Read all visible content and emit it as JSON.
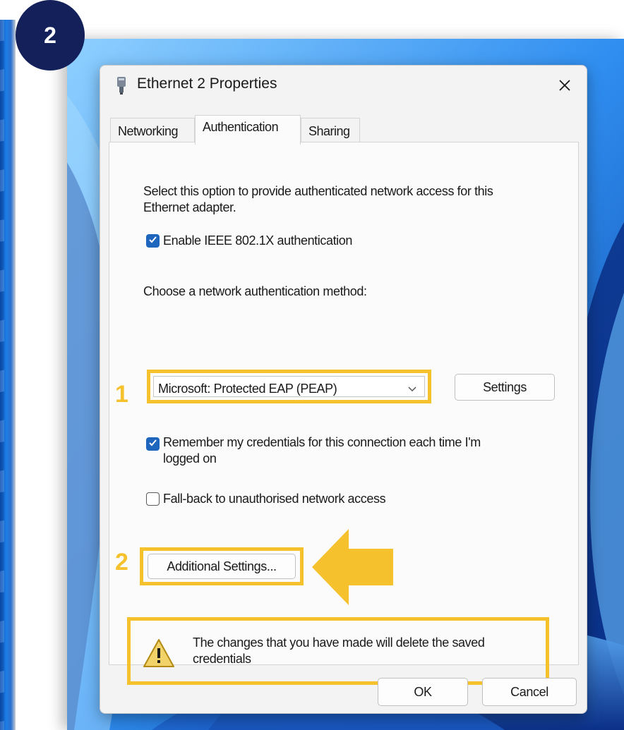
{
  "step_badge": "2",
  "dialog": {
    "title": "Ethernet 2 Properties",
    "close_glyph": "✕",
    "tabs": [
      {
        "label": "Networking"
      },
      {
        "label": "Authentication"
      },
      {
        "label": "Sharing"
      }
    ],
    "active_tab": "Authentication",
    "description": "Select this option to provide authenticated network access for this Ethernet adapter.",
    "enable_8021x": {
      "label": "Enable IEEE 802.1X authentication",
      "checked": true
    },
    "method_label": "Choose a network authentication method:",
    "method_select": {
      "value": "Microsoft: Protected EAP (PEAP)"
    },
    "settings_button": "Settings",
    "remember_credentials": {
      "label": "Remember my credentials for this connection each time I'm logged on",
      "checked": true
    },
    "fallback": {
      "label": "Fall-back to unauthorised network access",
      "checked": false
    },
    "additional_settings_button": "Additional Settings...",
    "warning_text": "The changes that you have made will delete the saved credentials",
    "ok_button": "OK",
    "cancel_button": "Cancel"
  },
  "annotations": {
    "callout_1": "1",
    "callout_2": "2",
    "highlight_color": "#f5c12d",
    "badge_color": "#13205a"
  },
  "icons": [
    "ethernet-adapter-icon",
    "close-icon",
    "chevron-down-icon",
    "checkmark-icon",
    "warning-icon",
    "pointing-arrow-icon"
  ]
}
